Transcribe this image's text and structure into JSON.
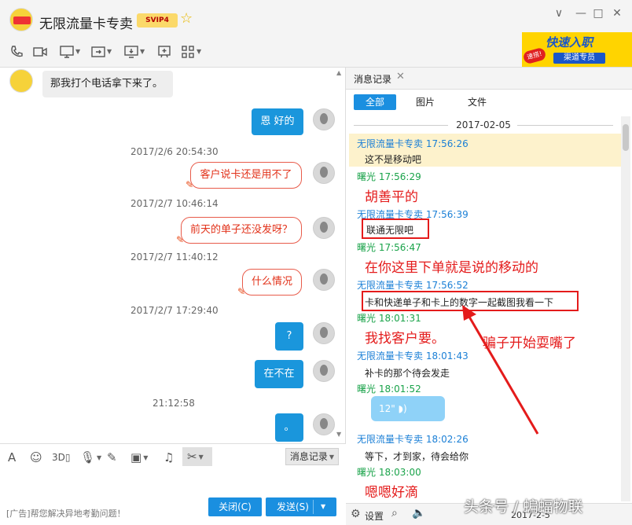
{
  "window": {
    "title": "无限流量卡专卖",
    "vip_badge": "SVIP4",
    "controls": [
      "minimize",
      "maximize",
      "close"
    ]
  },
  "toolbar": {
    "icons": [
      "phone-icon",
      "video-icon",
      "screen-share-icon",
      "send-file-icon",
      "remote-desktop-icon",
      "whiteboard-icon",
      "apps-icon"
    ]
  },
  "ad_banner": {
    "main": "快速入职",
    "tag": "速搭!",
    "sub": "渠道专员"
  },
  "chat": {
    "first_message": "那我打个电话拿下来了。",
    "messages": [
      {
        "type": "blue",
        "text": "恩 好的"
      },
      {
        "type": "time",
        "text": "2017/2/6 20:54:30"
      },
      {
        "type": "red",
        "text": "客户说卡还是用不了"
      },
      {
        "type": "time",
        "text": "2017/2/7 10:46:14"
      },
      {
        "type": "red",
        "text": "前天的单子还没发呀？"
      },
      {
        "type": "time",
        "text": "2017/2/7 11:40:12"
      },
      {
        "type": "red",
        "text": "什么情况"
      },
      {
        "type": "time",
        "text": "2017/2/7 17:29:40"
      },
      {
        "type": "blue",
        "text": "?"
      },
      {
        "type": "blue",
        "text": "在不在"
      },
      {
        "type": "time",
        "text": "21:12:58"
      },
      {
        "type": "blue",
        "text": "。"
      }
    ]
  },
  "input_bar": {
    "message_record_label": "消息记录",
    "close_label": "关闭(C)",
    "send_label": "发送(S)",
    "ad_text": "[广告]帮您解决异地考勤问题！"
  },
  "history": {
    "tab_label": "消息记录",
    "filters": [
      "全部",
      "图片",
      "文件"
    ],
    "date": "2017-02-05",
    "records": [
      {
        "sender": "无限流量卡专卖 17:56:26",
        "self": false,
        "text": "这不是移动吧"
      },
      {
        "sender": "曙光 17:56:29",
        "self": true,
        "text": ""
      },
      {
        "sender": "无限流量卡专卖 17:56:39",
        "self": false,
        "text": "联通无限吧"
      },
      {
        "sender": "曙光 17:56:47",
        "self": true,
        "text": ""
      },
      {
        "sender": "无限流量卡专卖 17:56:52",
        "self": false,
        "text": "卡和快递单子和卡上的数字一起截图我看一下"
      },
      {
        "sender": "曙光 18:01:31",
        "self": true,
        "text": ""
      },
      {
        "sender": "无限流量卡专卖 18:01:43",
        "self": false,
        "text": "补卡的那个待会发走"
      },
      {
        "sender": "曙光 18:01:52",
        "self": true,
        "text": ""
      },
      {
        "sender": "无限流量卡专卖 18:02:26",
        "self": false,
        "text": "等下，才到家，待会给你"
      },
      {
        "sender": "曙光 18:03:00",
        "self": true,
        "text": ""
      }
    ],
    "voice_label": "12\"",
    "annotations": [
      "胡善平的",
      "在你这里下单就是说的移动的",
      "我找客户要。",
      "骗子开始耍嘴了",
      "嗯嗯好滴"
    ],
    "bottom": {
      "settings_label": "设置",
      "date_partial": "2017-2-5"
    },
    "watermark": "头条号 / 蝙蝠物联"
  },
  "colors": {
    "accent_blue": "#1a96dc",
    "annotation_red": "#e41b1b"
  }
}
